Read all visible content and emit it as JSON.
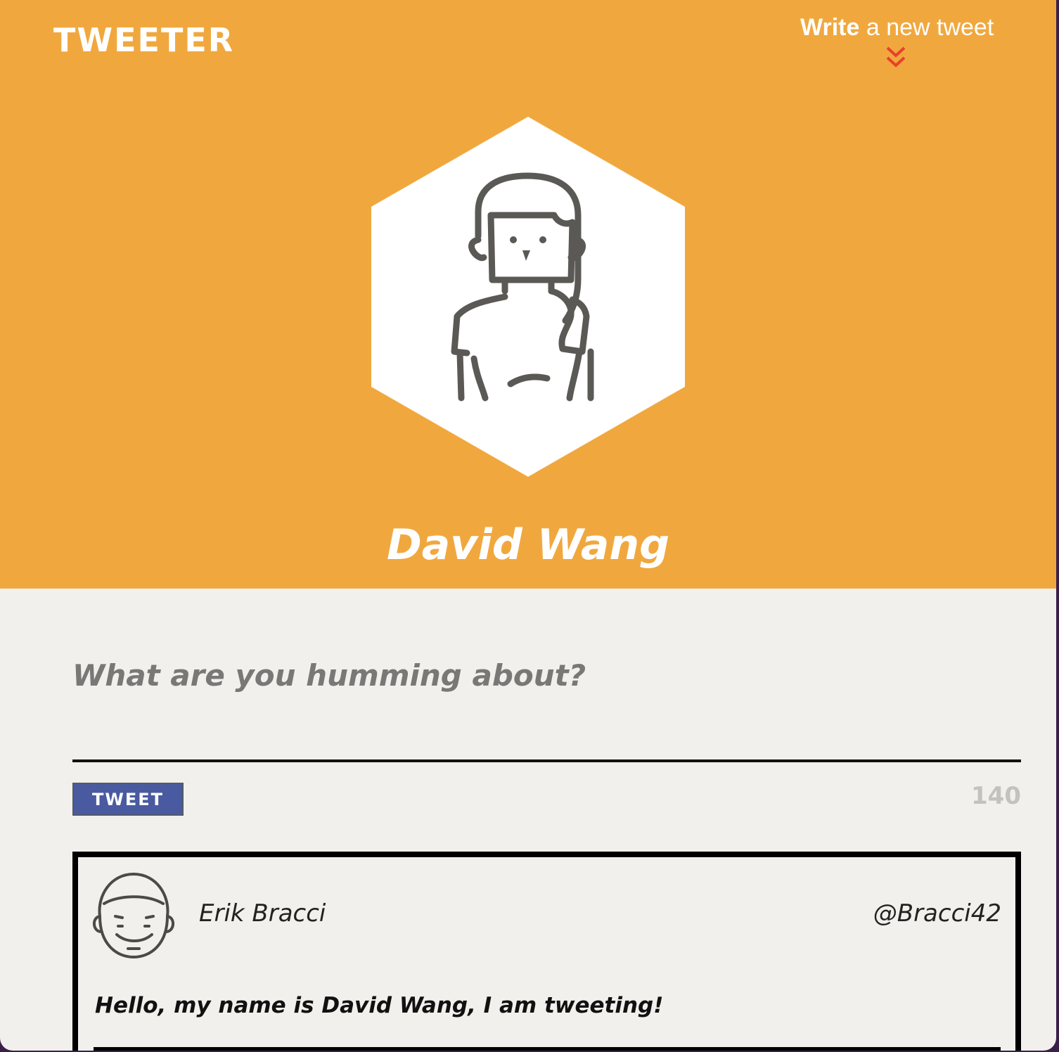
{
  "header": {
    "brand": "TWEETER",
    "compose_link_strong": "Write",
    "compose_link_rest": " a new tweet",
    "compose_icon": "double-chevron-down-icon"
  },
  "profile": {
    "name": "David Wang",
    "avatar_icon": "woman-avatar-icon"
  },
  "composer": {
    "placeholder": "What are you humming about?",
    "value": "",
    "submit_label": "TWEET",
    "char_count": "140"
  },
  "tweets": [
    {
      "author_name": "Erik Bracci",
      "handle": "@Bracci42",
      "text": "Hello, my name is David Wang, I am tweeting!",
      "avatar_icon": "smiling-man-avatar-icon"
    }
  ],
  "colors": {
    "hero_background": "#f0a83e",
    "page_background": "#f2f0ec",
    "button_background": "#4a5aa0",
    "chevron": "#e8412a",
    "counter": "#c4c2be"
  }
}
